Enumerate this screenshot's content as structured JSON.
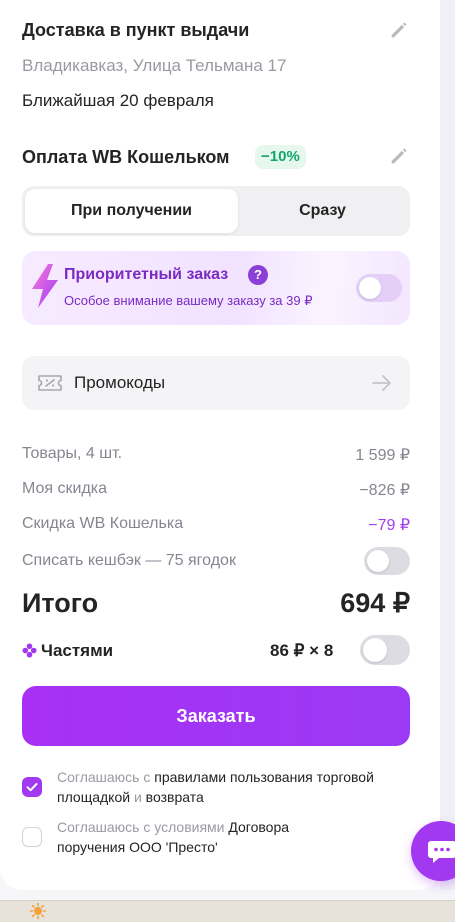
{
  "delivery": {
    "title": "Доставка в пункт выдачи",
    "address": "Владикавказ, Улица Тельмана 17",
    "date": "Ближайшая 20 февраля"
  },
  "payment": {
    "title": "Оплата WB Кошельком",
    "discount_badge": "−10%",
    "tabs": [
      "При получении",
      "Сразу"
    ],
    "selected_tab": "При получении"
  },
  "priority": {
    "title": "Приоритетный заказ",
    "help": "?",
    "subtitle": "Особое внимание вашему заказу за 39 ₽",
    "enabled": false
  },
  "promo": {
    "label": "Промокоды"
  },
  "summary": {
    "goods_label": "Товары, 4 шт.",
    "goods_value": "1 599 ₽",
    "my_discount_label": "Моя скидка",
    "my_discount_value": "−826 ₽",
    "wallet_discount_label": "Скидка WB Кошелька",
    "wallet_discount_value": "−79 ₽",
    "cashback_label": "Списать кешбэк — 75 ягодок",
    "cashback_enabled": false,
    "total_label": "Итого",
    "total_value": "694 ₽",
    "parts_label": "Частями",
    "parts_value": "86 ₽ × 8",
    "parts_enabled": false
  },
  "order_button": "Заказать",
  "agreements": [
    {
      "checked": true,
      "prefix": "Соглашаюсь с",
      "link1": "правилами пользования торговой площадкой",
      "mid": "и",
      "link2": "возврата"
    },
    {
      "checked": false,
      "prefix": "Соглашаюсь с условиями",
      "link1": "Договора поручения ООО 'Престо'"
    }
  ],
  "colors": {
    "accent": "#a238f0",
    "discount_green": "#11a66a",
    "wallet_purple": "#a23cf0"
  }
}
